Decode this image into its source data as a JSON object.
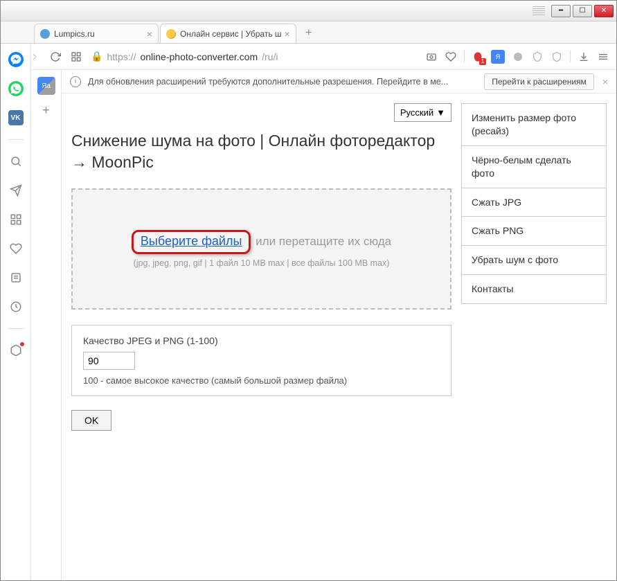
{
  "window": {
    "tabs": [
      {
        "title": "Lumpics.ru"
      },
      {
        "title": "Онлайн сервис | Убрать ш"
      }
    ],
    "url_prefix": "https://",
    "url_host": "online-photo-converter.com",
    "url_path": "/ru/i"
  },
  "notif": {
    "text": "Для обновления расширений требуются дополнительные разрешения. Перейдите в ме...",
    "button": "Перейти к расширениям"
  },
  "page": {
    "lang": "Русский",
    "title": "Снижение шума на фото | Онлайн фоторедактор → MoonPic",
    "choose_files": "Выберите файлы",
    "drag_text": "или перетащите их сюда",
    "formats_hint": "(jpg, jpeg, png, gif | 1 файл 10 MB max | все файлы 100 MB max)",
    "quality_label": "Качество JPEG и PNG (1-100)",
    "quality_value": "90",
    "quality_note": "100 - самое высокое качество (самый большой размер файла)",
    "ok": "OK"
  },
  "nav": {
    "items": [
      "Изменить размер фото (ресайз)",
      "Чёрно-белым сделать фото",
      "Сжать JPG",
      "Сжать PNG",
      "Убрать шум с фото",
      "Контакты"
    ]
  }
}
